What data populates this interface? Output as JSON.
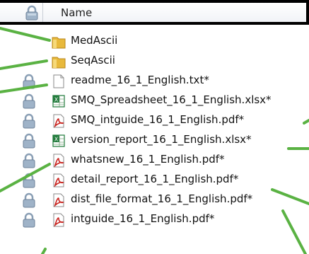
{
  "header": {
    "lock_column_icon": "lock-icon",
    "name_column_label": "Name"
  },
  "colors": {
    "folder": "#e8b93c",
    "excel": "#1f7a3a",
    "pdf": "#c9231e",
    "leader": "#5ab243"
  },
  "files": [
    {
      "name": "MedAscii",
      "type": "folder",
      "locked": false
    },
    {
      "name": "SeqAscii",
      "type": "folder",
      "locked": false
    },
    {
      "name": "readme_16_1_English.txt*",
      "type": "txt",
      "locked": true
    },
    {
      "name": "SMQ_Spreadsheet_16_1_English.xlsx*",
      "type": "xlsx",
      "locked": true
    },
    {
      "name": "SMQ_intguide_16_1_English.pdf*",
      "type": "pdf",
      "locked": true
    },
    {
      "name": "version_report_16_1_English.xlsx*",
      "type": "xlsx",
      "locked": true
    },
    {
      "name": "whatsnew_16_1_English.pdf*",
      "type": "pdf",
      "locked": true
    },
    {
      "name": "detail_report_16_1_English.pdf*",
      "type": "pdf",
      "locked": true
    },
    {
      "name": "dist_file_format_16_1_English.pdf*",
      "type": "pdf",
      "locked": true
    },
    {
      "name": "intguide_16_1_English.pdf*",
      "type": "pdf",
      "locked": true
    }
  ]
}
